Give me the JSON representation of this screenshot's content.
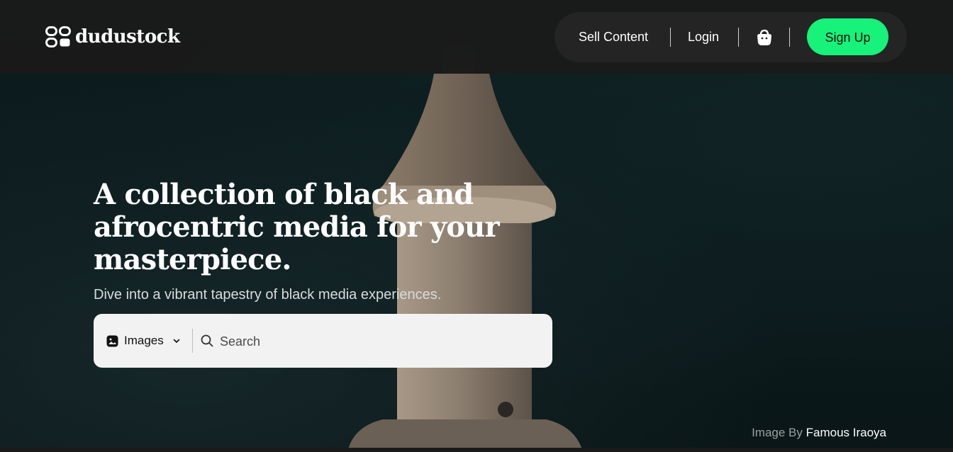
{
  "brand": {
    "name": "dudustock"
  },
  "nav": {
    "sell_content": "Sell Content",
    "login": "Login",
    "sign_up": "Sign Up",
    "cart_icon": "shopping-bag-icon"
  },
  "hero": {
    "headline": "A collection of black and afrocentric media for your masterpiece.",
    "subtitle": "Dive into a vibrant tapestry of black media experiences."
  },
  "search": {
    "type_selected": "Images",
    "placeholder": "Search",
    "value": ""
  },
  "credit": {
    "prefix": "Image By",
    "author": "Famous Iraoya"
  },
  "colors": {
    "accent": "#16f27a",
    "header_bg": "#1a1a1a",
    "nav_pill_bg": "#242424",
    "hero_bg": "#0b1a1c"
  }
}
